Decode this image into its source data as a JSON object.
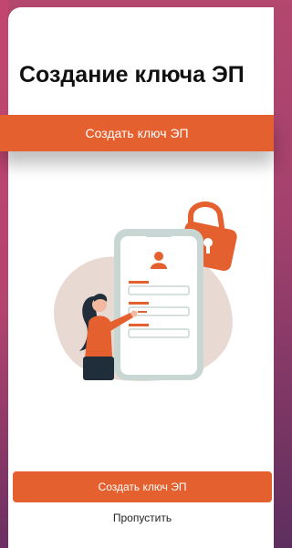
{
  "screen": {
    "title": "Создание ключа ЭП",
    "banner_label": "Создать ключ ЭП"
  },
  "illustration": {
    "icon": "lock-phone-user-illustration",
    "accent_color": "#e5602f",
    "phone_color": "#c9d7d4"
  },
  "actions": {
    "primary_label": "Создать ключ ЭП",
    "skip_label": "Пропустить"
  },
  "colors": {
    "accent": "#e5602f",
    "background": "#a3416d"
  }
}
